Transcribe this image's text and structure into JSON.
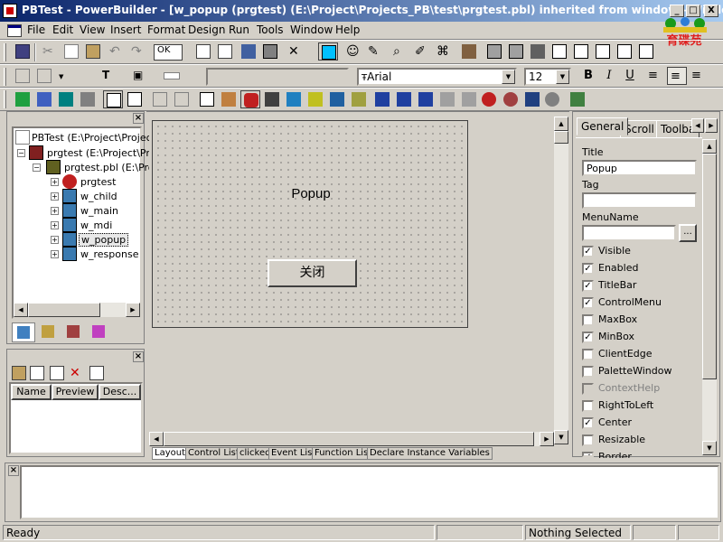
{
  "window": {
    "title": "PBTest - PowerBuilder - [w_popup (prgtest) (E:\\Project\\Projects_PB\\test\\prgtest.pbl) inherited from window - Window]",
    "controls": [
      "_",
      "□",
      "X"
    ]
  },
  "menubar": {
    "items": [
      "File",
      "Edit",
      "View",
      "Insert",
      "Format",
      "Design",
      "Run",
      "Tools",
      "Window",
      "Help"
    ]
  },
  "toolbar_font": {
    "font_name": "Arial",
    "font_size": "12",
    "bold": "B",
    "italic": "I",
    "underline": "U"
  },
  "toolbar_zoom": "OK",
  "library_tree": {
    "items": [
      {
        "label": "PBTest (E:\\Project\\Projec"
      },
      {
        "label": "prgtest (E:\\Project\\Pr"
      },
      {
        "label": "prgtest.pbl (E:\\Proc"
      },
      {
        "label": "prgtest"
      },
      {
        "label": "w_child"
      },
      {
        "label": "w_main"
      },
      {
        "label": "w_mdi"
      },
      {
        "label": "w_popup"
      },
      {
        "label": "w_response"
      }
    ]
  },
  "list_panel": {
    "columns": [
      "Name",
      "Preview",
      "Desc..."
    ]
  },
  "design": {
    "popup_title": "Popup",
    "close_button": "关闭"
  },
  "layout_tabs": [
    "Layout",
    "Control List",
    "clicked",
    "Event List",
    "Function List",
    "Declare Instance Variables"
  ],
  "properties": {
    "tabs": [
      "General",
      "Scroll",
      "Toolba"
    ],
    "title_label": "Title",
    "title_value": "Popup",
    "tag_label": "Tag",
    "tag_value": "",
    "menuname_label": "MenuName",
    "menuname_value": "",
    "browse_button": "...",
    "checkboxes": [
      {
        "label": "Visible",
        "mark": "✓"
      },
      {
        "label": "Enabled",
        "mark": "✓"
      },
      {
        "label": "TitleBar",
        "mark": "✓"
      },
      {
        "label": "ControlMenu",
        "mark": "✓"
      },
      {
        "label": "MaxBox",
        "mark": ""
      },
      {
        "label": "MinBox",
        "mark": "✓"
      },
      {
        "label": "ClientEdge",
        "mark": ""
      },
      {
        "label": "PaletteWindow",
        "mark": ""
      },
      {
        "label": "ContextHelp",
        "mark": ""
      },
      {
        "label": "RightToLeft",
        "mark": ""
      },
      {
        "label": "Center",
        "mark": "✓"
      },
      {
        "label": "Resizable",
        "mark": ""
      },
      {
        "label": "Border",
        "mark": "✓"
      }
    ]
  },
  "statusbar": {
    "status": "Ready",
    "selection": "Nothing Selected"
  },
  "logo": {
    "text": "育碟苑"
  },
  "colors": {
    "title_start": "#0a246a",
    "title_end": "#a6caf0",
    "face": "#d4d0c8",
    "selection": "#000080"
  }
}
